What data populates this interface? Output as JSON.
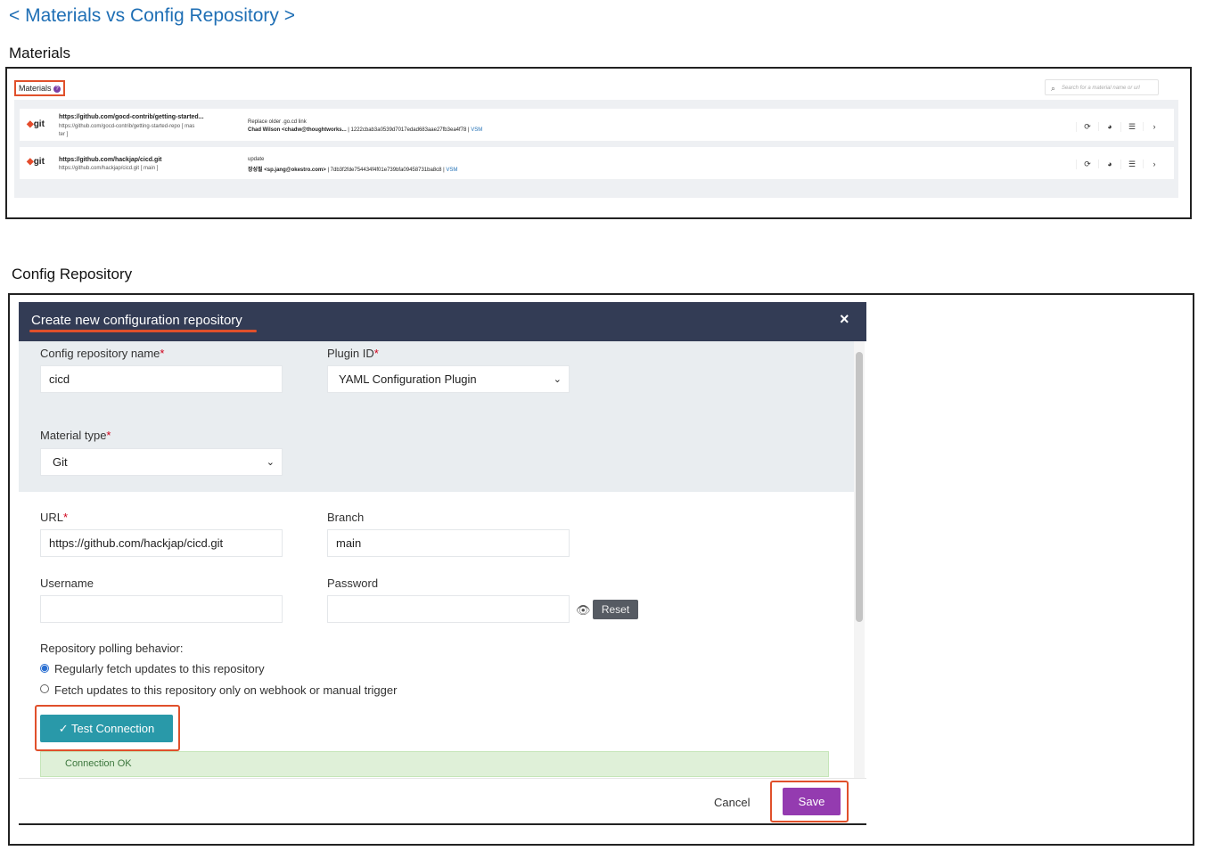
{
  "nav": {
    "title": "< Materials vs Config Repository >"
  },
  "materials_section": {
    "label": "Materials",
    "panel": {
      "heading": "Materials",
      "help_icon": "question-icon",
      "search_placeholder": "Search for a material name or url",
      "rows": [
        {
          "type": "git",
          "name": "https://github.com/gocd-contrib/getting-started...",
          "url_line1": "https://github.com/gocd-contrib/getting-started-repo [ mas",
          "url_line2": "ter ]",
          "commit_message": "Replace older .go.cd link",
          "revision_author": "Chad Wilson <chadw@thoughtworks...",
          "revision_rest": " | 1222cbab3a0539d7017edad683aae27fb3ea4f78 | ",
          "vsm": "VSM"
        },
        {
          "type": "git",
          "name": "https://github.com/hackjap/cicd.git",
          "url_line1": "https://github.com/hackjap/cicd.git [ main ]",
          "url_line2": "",
          "commit_message": "update",
          "revision_author": "장성필 <sp.jang@okestro.com>",
          "revision_rest": " | 7db3f2fde754434f4f01e739bfa09458731ba8c8 | ",
          "vsm": "VSM"
        }
      ]
    }
  },
  "config_section": {
    "label": "Config Repository",
    "modal": {
      "title": "Create new configuration repository",
      "close": "×",
      "fields": {
        "name_label": "Config repository name",
        "name_value": "cicd",
        "plugin_label": "Plugin ID",
        "plugin_value": "YAML Configuration Plugin",
        "material_type_label": "Material type",
        "material_type_value": "Git",
        "url_label": "URL",
        "url_value": "https://github.com/hackjap/cicd.git",
        "branch_label": "Branch",
        "branch_value": "main",
        "username_label": "Username",
        "username_value": "",
        "password_label": "Password",
        "password_value": "",
        "required_mark": "*"
      },
      "reset_label": "Reset",
      "polling": {
        "label": "Repository polling behavior:",
        "options": [
          {
            "label": "Regularly fetch updates to this repository",
            "selected": true
          },
          {
            "label": "Fetch updates to this repository only on webhook or manual trigger",
            "selected": false
          }
        ]
      },
      "test_connection_label": "Test Connection",
      "test_check": "✓",
      "connection_status": "Connection OK",
      "cancel_label": "Cancel",
      "save_label": "Save"
    }
  },
  "colors": {
    "link": "#1f6fb5",
    "highlight": "#e0502b",
    "modal_header": "#333c55",
    "test_button": "#2999a9",
    "save_button": "#943bb0",
    "success_bg": "#dff0d8"
  }
}
